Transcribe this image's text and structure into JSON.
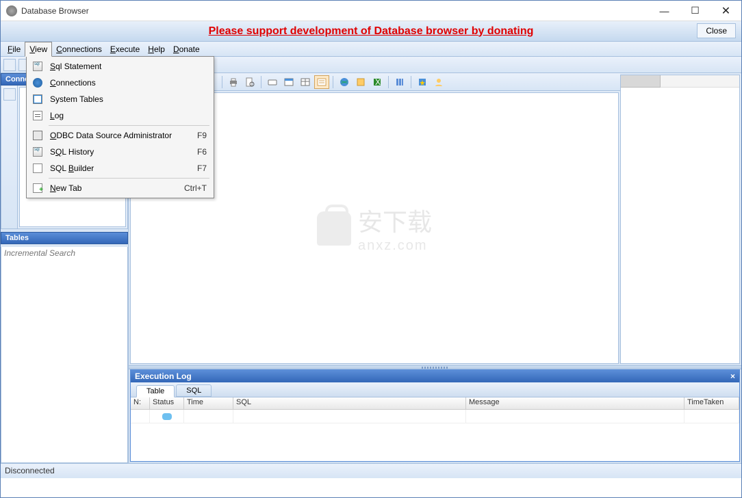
{
  "window": {
    "title": "Database Browser"
  },
  "banner": {
    "message": "Please support development of Database browser by donating",
    "close": "Close"
  },
  "menubar": {
    "file": "File",
    "view": "View",
    "connections": "Connections",
    "execute": "Execute",
    "help": "Help",
    "donate": "Donate"
  },
  "viewmenu": {
    "sql_statement": "Sql Statement",
    "connections": "Connections",
    "system_tables": "System Tables",
    "log": "Log",
    "odbc": "ODBC Data Source Administrator",
    "odbc_sc": "F9",
    "history": "SQL History",
    "history_sc": "F6",
    "builder": "SQL Builder",
    "builder_sc": "F7",
    "newtab": "New Tab",
    "newtab_sc": "Ctrl+T"
  },
  "panels": {
    "connections": "Connections",
    "tables": "Tables",
    "tables_placeholder": "Incremental Search",
    "execlog": "Execution Log"
  },
  "exectabs": {
    "table": "Table",
    "sql": "SQL"
  },
  "gridcols": {
    "n": "N:",
    "status": "Status",
    "time": "Time",
    "sql": "SQL",
    "message": "Message",
    "timetaken": "TimeTaken"
  },
  "watermark": {
    "text": "安下载",
    "sub": "anxz.com"
  },
  "status": "Disconnected"
}
